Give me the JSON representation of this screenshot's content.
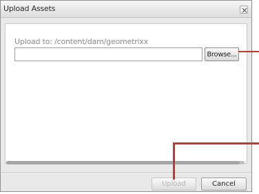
{
  "dialog": {
    "title": "Upload Assets",
    "close_icon": "close-icon",
    "upload_to_text": "Upload to: /content/dam/geometrixx",
    "file_input_value": "",
    "browse_label": "Browse...",
    "progress": 0.98,
    "upload_label": "Upload",
    "cancel_label": "Cancel"
  },
  "colors": {
    "annotation": "#c0392b",
    "dialog_bg": "#e9e9e9",
    "panel_bg": "#ffffff"
  }
}
